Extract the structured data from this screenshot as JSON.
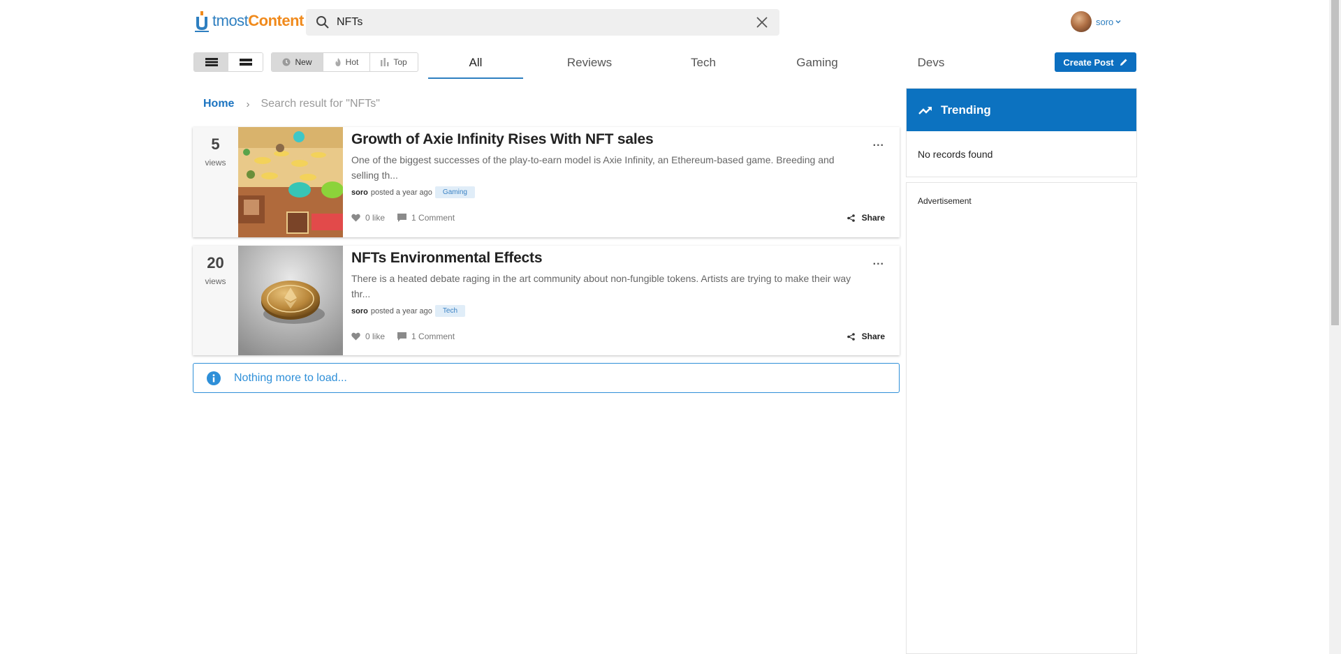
{
  "brand": {
    "logo_part1": "tmost",
    "logo_part2": "Content",
    "accent": "#2e7fc0",
    "orange": "#f08a1c"
  },
  "search": {
    "value": "NFTs",
    "icon": "search-icon",
    "clear_icon": "close-icon"
  },
  "user": {
    "name": "soro"
  },
  "toolbar": {
    "sort": [
      {
        "label": "New",
        "icon": "clock-icon",
        "active": true
      },
      {
        "label": "Hot",
        "icon": "flame-icon",
        "active": false
      },
      {
        "label": "Top",
        "icon": "bar-chart-icon",
        "active": false
      }
    ],
    "create_label": "Create Post"
  },
  "tabs": [
    "All",
    "Reviews",
    "Tech",
    "Gaming",
    "Devs"
  ],
  "breadcrumb": {
    "home": "Home",
    "sep": "›",
    "current": "Search result for \"NFTs\""
  },
  "posts": [
    {
      "views": "5",
      "views_label": "views",
      "title": "Growth of Axie Infinity Rises With NFT sales",
      "excerpt": "One of the biggest successes of the play-to-earn model is Axie Infinity, an Ethereum-based game. Breeding and selling th...",
      "author": "soro",
      "posted": "posted a year ago",
      "tag": "Gaming",
      "likes": "0 like",
      "comments": "1 Comment",
      "share": "Share",
      "more": "..."
    },
    {
      "views": "20",
      "views_label": "views",
      "title": "NFTs Environmental Effects",
      "excerpt": "There is a heated debate raging in the art community about non-fungible tokens. Artists are trying to make their way thr...",
      "author": "soro",
      "posted": "posted a year ago",
      "tag": "Tech",
      "likes": "0 like",
      "comments": "1 Comment",
      "share": "Share",
      "more": "..."
    }
  ],
  "status": {
    "nothing_more": "Nothing more to load..."
  },
  "sidebar": {
    "trending_title": "Trending",
    "trending_empty": "No records found",
    "ad_label": "Advertisement"
  }
}
